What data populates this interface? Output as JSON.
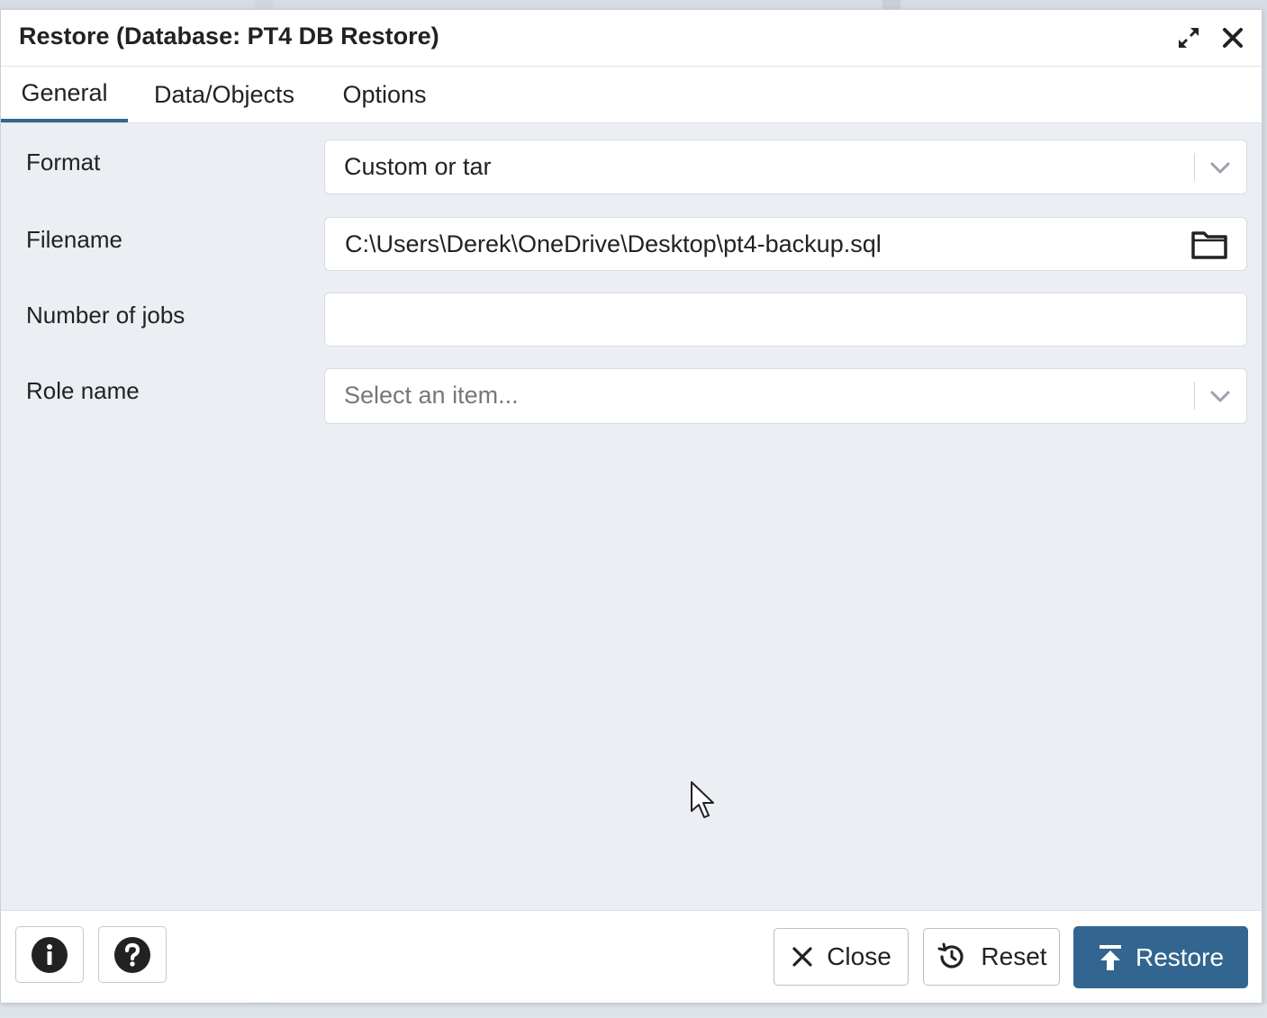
{
  "dialog": {
    "title": "Restore (Database: PT4 DB Restore)"
  },
  "tabs": [
    {
      "label": "General",
      "active": true
    },
    {
      "label": "Data/Objects",
      "active": false
    },
    {
      "label": "Options",
      "active": false
    }
  ],
  "form": {
    "format": {
      "label": "Format",
      "value": "Custom or tar"
    },
    "filename": {
      "label": "Filename",
      "value": "C:\\Users\\Derek\\OneDrive\\Desktop\\pt4-backup.sql"
    },
    "jobs": {
      "label": "Number of jobs",
      "value": ""
    },
    "role": {
      "label": "Role name",
      "placeholder": "Select an item..."
    }
  },
  "footer": {
    "close_label": "Close",
    "reset_label": "Reset",
    "restore_label": "Restore"
  },
  "icons": {
    "maximize": "expand-icon",
    "close": "close-icon",
    "info": "info-icon",
    "help": "help-icon",
    "folder": "folder-icon",
    "reset": "reset-icon",
    "restore": "upload-icon"
  },
  "colors": {
    "accent": "#326690",
    "content_bg": "#ebeef3"
  }
}
